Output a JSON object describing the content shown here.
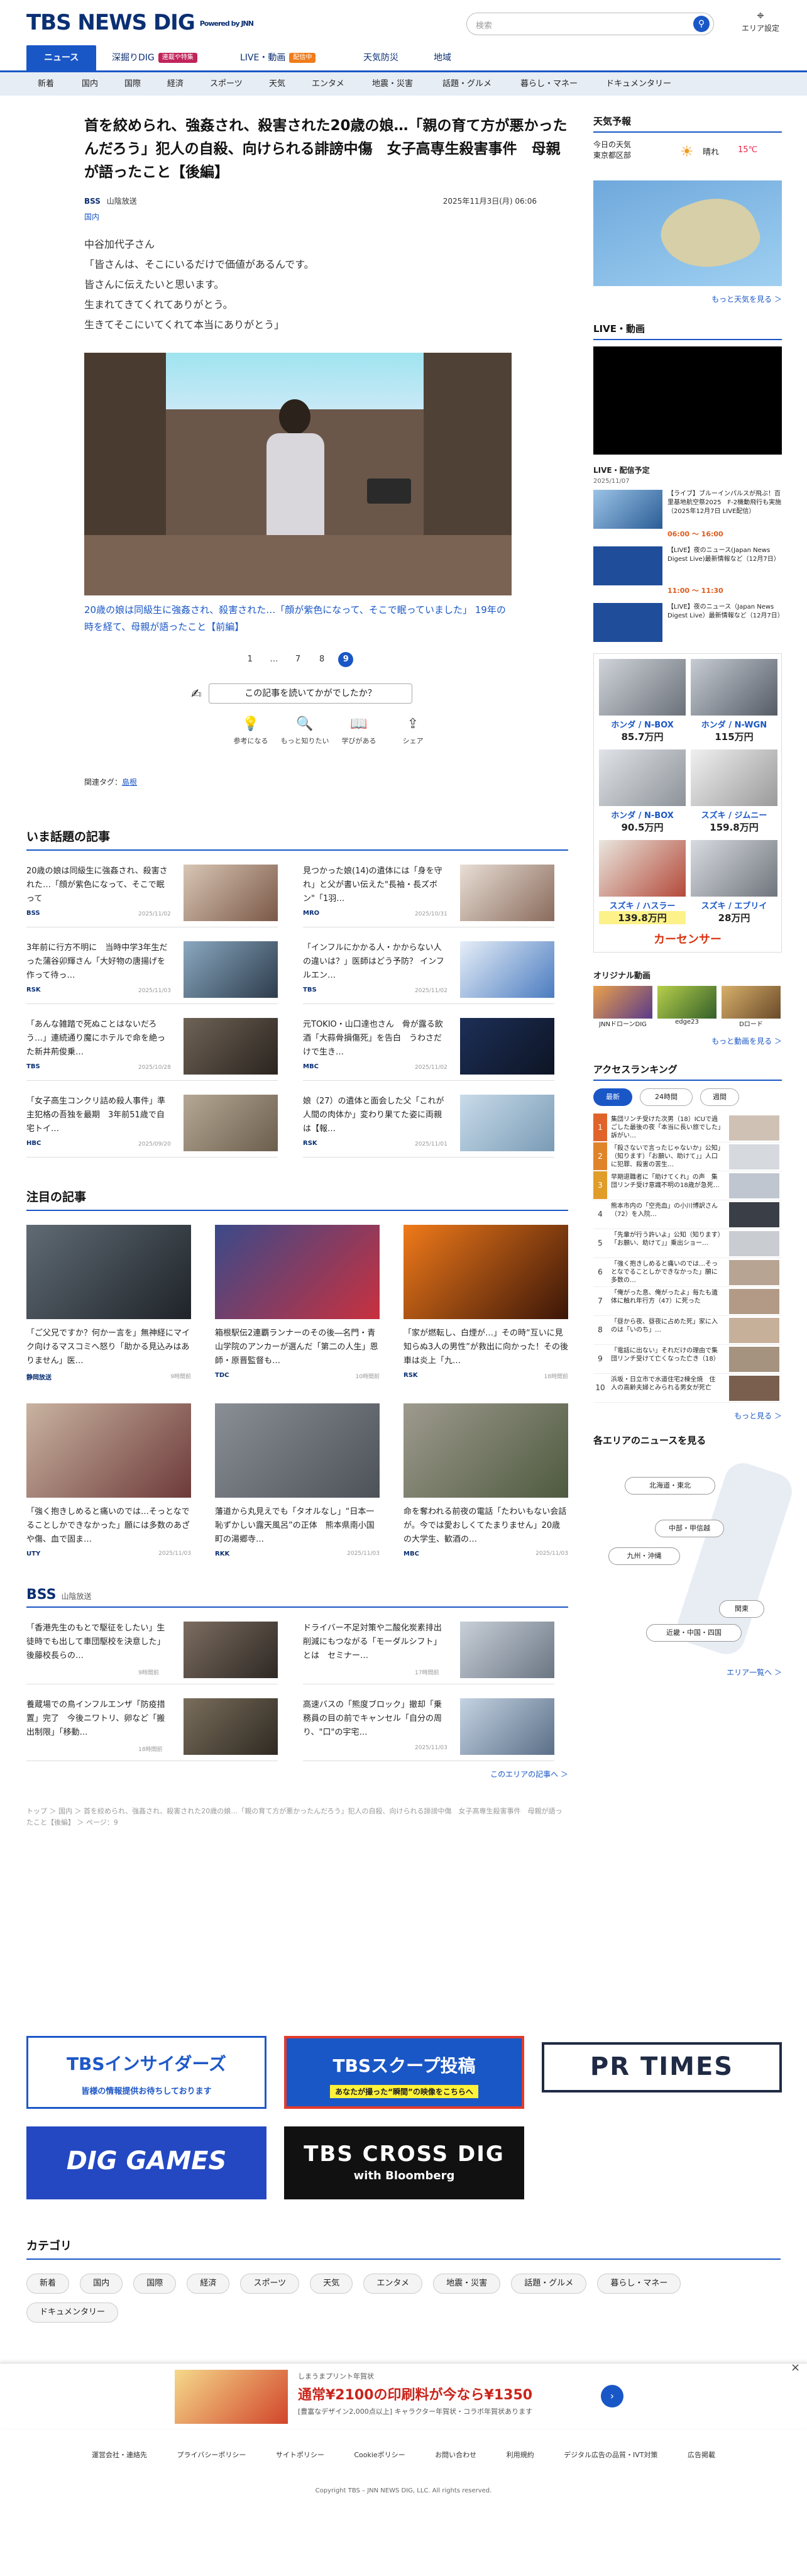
{
  "header": {
    "logo": "TBS NEWS DIG",
    "powered": "Powered by JNN",
    "search_placeholder": "検索",
    "area_label": "エリア設定"
  },
  "nav1": [
    {
      "label": "ニュース"
    },
    {
      "label": "深掘りDIG",
      "badge": "連載や特集"
    },
    {
      "label": "LIVE・動画",
      "badge": "配信中"
    },
    {
      "label": "天気防災"
    },
    {
      "label": "地域"
    }
  ],
  "nav2": [
    "新着",
    "国内",
    "国際",
    "経済",
    "スポーツ",
    "天気",
    "エンタメ",
    "地震・災害",
    "話題・グルメ",
    "暮らし・マネー",
    "ドキュメンタリー"
  ],
  "article": {
    "title": "首を絞められ、強姦され、殺害された20歳の娘…「親の育て方が悪かったんだろう」犯人の自殺、向けられる誹謗中傷　女子高専生殺害事件　母親が語ったこと【後編】",
    "source": "BSS",
    "source_name": "山陰放送",
    "date": "2025年11月3日(月) 06:06",
    "category": "国内",
    "body": [
      "中谷加代子さん",
      "「皆さんは、そこにいるだけで価値があるんです。",
      "皆さんに伝えたいと思います。",
      "生まれてきてくれてありがとう。",
      "生きてそこにいてくれて本当にありがとう」"
    ],
    "caption": "20歳の娘は同級生に強姦され、殺害された…「顔が紫色になって、そこで眠っていました」 19年の時を経て、母親が語ったこと【前編】",
    "pages": [
      "1",
      "…",
      "7",
      "8",
      "9"
    ],
    "rate_q": "この記事を読いてかがでしたか？",
    "reactions": [
      "参考になる",
      "もっと知りたい",
      "学びがある",
      "シェア"
    ],
    "related_label": "関連タグ：",
    "related_tag": "島根"
  },
  "trending": {
    "heading": "いま話題の記事",
    "items": [
      {
        "title": "20歳の娘は同級生に強姦され、殺害された…「顔が紫色になって、そこで眠って",
        "src": "BSS",
        "date": "2025/11/02"
      },
      {
        "title": "見つかった娘(14)の遺体には「身を守れ」と父が書い伝えた\"長袖・長ズボン\"「1羽…",
        "src": "MRO",
        "date": "2025/10/31"
      },
      {
        "title": "3年前に行方不明に　当時中学3年生だった蒲谷卯輝さん「大好物の唐揚げを作って待っ…",
        "src": "RSK",
        "date": "2025/11/03"
      },
      {
        "title": "「インフルにかかる人・かからない人の違いは？」医師はどう予防？ インフルエン…",
        "src": "TBS",
        "date": "2025/11/02"
      },
      {
        "title": "「あんな雑踏で死ぬことはないだろう…」連続通り魔にホテルで命を絶った新井荊俊乗…",
        "src": "TBS",
        "date": "2025/10/28"
      },
      {
        "title": "元TOKIO・山口達也さん　骨が露る飲酒「大蒜骨損傷死」を告白　うわさだけで生き…",
        "src": "MBC",
        "date": "2025/11/02"
      },
      {
        "title": "「女子高生コンクリ詰め殺人事件」準主犯格の吾独を最期　3年前51歳で自宅トイ…",
        "src": "HBC",
        "date": "2025/09/20"
      },
      {
        "title": "娘（27）の遺体と面会した父「これが人間の肉体か」変わり果てた姿に両親は【報…",
        "src": "RSK",
        "date": "2025/11/01"
      }
    ]
  },
  "featured": {
    "heading": "注目の記事",
    "items": [
      {
        "title": "「ご父兄ですか？何かー言を」無神経にマイク向けるマスコミへ怒り「助かる見込みはありません」医…",
        "src": "静岡放送",
        "date": "9時間前"
      },
      {
        "title": "箱根駅伝2連覇ランナーのその後―名門・青山学院のアンカーが選んだ「第二の人生」恩師・原晋監督も…",
        "src": "TDC",
        "date": "10時間前"
      },
      {
        "title": "「家が燃転し、白煙が…」その時“互いに見知らぬ3人の男性”が救出に向かった！その後 車は炎上「九…",
        "src": "RSK",
        "date": "18時間前"
      },
      {
        "title": "「強く抱きしめると痛いのでは…そっとなでることしかできなかった」願には多数のあざや傷、血で固ま…",
        "src": "UTY",
        "date": "2025/11/03"
      },
      {
        "title": "藩道から丸見えでも「タオルなし」“日本一恥ずかしい露天風呂”の正体　熊本県南小国町の湯郷寺…",
        "src": "RKK",
        "date": "2025/11/03"
      },
      {
        "title": "命を奪われる前夜の電話「たわいもない会話が。今では愛おしくてたまりません」20歳の大学生、歓酒の…",
        "src": "MBC",
        "date": "2025/11/03"
      }
    ]
  },
  "local": {
    "src": "BSS",
    "name": "山陰放送",
    "items": [
      {
        "title": "「香港先生のもとで駆征をしたい」生徒時でも出して車団駆校を決意した」後藤校長らの…",
        "date": "9時間前"
      },
      {
        "title": "ドライバー不足対策や二酸化炭素排出削減にもつながる「モーダルシフト」とは　セミナー…",
        "date": "17時間前"
      },
      {
        "title": "養蔵場での鳥インフルエンザ「防疫措置」完了　今後ニワトリ、卵など「搬出制限」「移動…",
        "date": "18時間前"
      },
      {
        "title": "高速バスの「熊度ブロック」撤却「乗務員の目の前でキャンセル「自分の周り、\"口\"の宇宅…",
        "date": "2025/11/03"
      }
    ],
    "more": "このエリアの記事へ ＞"
  },
  "breadcrumb": "トップ ＞ 国内 ＞ 首を絞められ、強姦され、殺害された20歳の娘…「親の育て方が悪かったんだろう」犯人の自殺、向けられる誹謗中傷　女子高専生殺害事件　母親が語ったこと【後編】 ＞ ページ：9",
  "banners": {
    "b1": "TBSインサイダーズ",
    "b1sub": "皆様の情報提供お待ちしております",
    "b2": "TBSスクープ投稿",
    "b2sub": "あなたが撮った“瞬間”の映像をこちらへ",
    "b3": "PR TIMES",
    "b4": "DIG GAMES",
    "b5": "TBS CROSS DIG",
    "b5sub": "with Bloomberg"
  },
  "categories": {
    "heading": "カテゴリ",
    "items": [
      "新着",
      "国内",
      "国際",
      "経済",
      "スポーツ",
      "天気",
      "エンタメ",
      "地震・災害",
      "話題・グルメ",
      "暮らし・マネー",
      "ドキュメンタリー"
    ]
  },
  "ad": {
    "brand": "しまうまプリント年賀状",
    "main": "通常¥2100の印刷料が今なら¥1350",
    "sub": "[豊富なデザイン2,000点以上] キャラクター年賀状・コラボ年賀状あります"
  },
  "footer": {
    "links": [
      "運営会社・連絡先",
      "プライバシーポリシー",
      "サイトポリシー",
      "Cookieポリシー",
      "お問い合わせ",
      "利用規約",
      "デジタル広告の品質・IVT対策",
      "広告掲載"
    ],
    "copyright": "Copyright TBS – JNN NEWS DIG, LLC. All rights reserved."
  },
  "sidebar": {
    "weather": {
      "heading": "天気予報",
      "today": "今日の天気",
      "place": "東京都区部",
      "cond": "晴れ",
      "temp": "15℃",
      "more": "もっと天気を見る ＞"
    },
    "live": {
      "heading": "LIVE・動画",
      "sched": "LIVE・配信予定",
      "date": "2025/11/07",
      "items": [
        {
          "title": "【ライブ】ブルーインパルスが飛ぶ！百里基地航空祭2025　F-2機動飛行も実施（2025年12月7日 LIVE配信）",
          "time": "06:00 ～ 16:00"
        },
        {
          "title": "【LIVE】夜のニュース(Japan News Digest Live)最新情報など（12月7日）",
          "time": "11:00 ～ 11:30"
        },
        {
          "title": "【LIVE】夜のニュース（Japan News Digest Live）最新情報など（12月7日）",
          "time": ""
        }
      ]
    },
    "cars": [
      {
        "name": "ホンダ / N-BOX",
        "price": "85.7万円"
      },
      {
        "name": "ホンダ / N-WGN",
        "price": "115万円"
      },
      {
        "name": "ホンダ / N-BOX",
        "price": "90.5万円"
      },
      {
        "name": "スズキ / ジムニー",
        "price": "159.8万円"
      },
      {
        "name": "スズキ / ハスラー",
        "price": "139.8万円"
      },
      {
        "name": "スズキ / エブリイ",
        "price": "28万円"
      }
    ],
    "carsensor": "カーセンサー",
    "orig": {
      "heading": "オリジナル動画",
      "items": [
        "JNNドローンDIG",
        "edge23",
        "Dロード"
      ],
      "more": "もっと動画を見る ＞"
    },
    "ranking": {
      "heading": "アクセスランキング",
      "tabs": [
        "最新",
        "24時間",
        "週間"
      ],
      "items": [
        "集団リンチ受けた次男（18）ICUで過ごした最後の夜「本当に長い旅でした」訴がい…",
        "「殺さないで言ったじゃないか」公知」（知ります）「お願い、助けて」」人口に犯罪、殺害の苦生…",
        "早期退職者に「助けてくれ」の声　集団リンチ受け意識不明の18歳が急死…",
        "熊本市内の「空売血」の小川博訳さん（72）を入院…",
        "「先輩が行う許いよ」公知（知ります）「お願い、助けて」」乗出ショー…",
        "「強く抱きしめると痛いのでは…そっとなでることしかできなかった」願に多数の…",
        "「俺がった息、俺がったよ」毎たも遺体に触れ年行方（47）に死った",
        "「昼から夜、昼夜に占めた死」家に入のは「いのち」…",
        "「電話に出ない」それだけの理由で集団リンチ受けて亡くなった亡き（18）",
        "浜坂・日立市で水道住宅2棟全焼　住人の高齢夫婦とみられる男女が死亡"
      ],
      "more": "もっと見る ＞"
    },
    "area": {
      "heading": "各エリアのニュースを見る",
      "regions": [
        "北海道・東北",
        "中部・甲信越",
        "九州・沖縄",
        "関東",
        "近畿・中国・四国"
      ],
      "more": "エリア一覧へ ＞"
    }
  }
}
